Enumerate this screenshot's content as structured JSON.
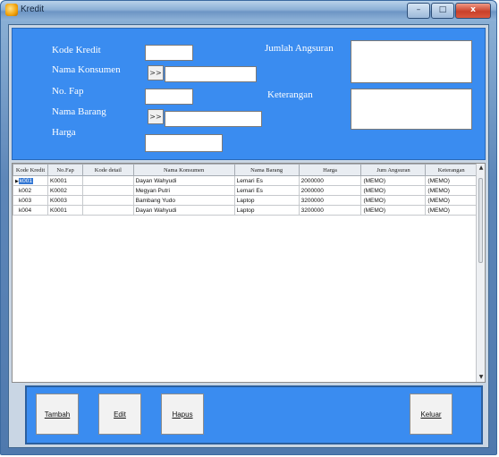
{
  "window": {
    "title": "Kredit",
    "minimize_glyph": "–",
    "maximize_glyph": "□",
    "close_glyph": "x"
  },
  "form": {
    "kode_kredit_label": "Kode Kredit",
    "nama_konsumen_label": "Nama Konsumen",
    "no_fap_label": "No. Fap",
    "nama_barang_label": "Nama Barang",
    "harga_label": "Harga",
    "jumlah_angsuran_label": "Jumlah Angsuran",
    "keterangan_label": "Keterangan",
    "lookup_glyph": ">>",
    "kode_kredit_value": "",
    "nama_konsumen_value": "",
    "no_fap_value": "",
    "nama_barang_value": "",
    "harga_value": "",
    "jumlah_angsuran_value": "",
    "keterangan_value": ""
  },
  "grid": {
    "columns": [
      "Kode Kredit",
      "No.Fap",
      "Kode detail",
      "Nama Konsumen",
      "Nama Barang",
      "Harga",
      "Jum Angsuran",
      "Keterangan"
    ],
    "rows": [
      [
        "k001",
        "K0001",
        "",
        "Dayan Wahyudi",
        "Lemari Es",
        "2000000",
        "(MEMO)",
        "(MEMO)"
      ],
      [
        "k002",
        "K0002",
        "",
        "Megyan Putri",
        "Lemari Es",
        "2000000",
        "(MEMO)",
        "(MEMO)"
      ],
      [
        "k003",
        "K0003",
        "",
        "Bambang Yudo",
        "Laptop",
        "3200000",
        "(MEMO)",
        "(MEMO)"
      ],
      [
        "k004",
        "K0001",
        "",
        "Dayan Wahyudi",
        "Laptop",
        "3200000",
        "(MEMO)",
        "(MEMO)"
      ]
    ],
    "row_indicator": "▶"
  },
  "buttons": {
    "tambah": "Tambah",
    "edit": "Edit",
    "hapus": "Hapus",
    "keluar": "Keluar"
  },
  "colors": {
    "panel_blue": "#3a8cf0",
    "selection": "#3377d4"
  }
}
